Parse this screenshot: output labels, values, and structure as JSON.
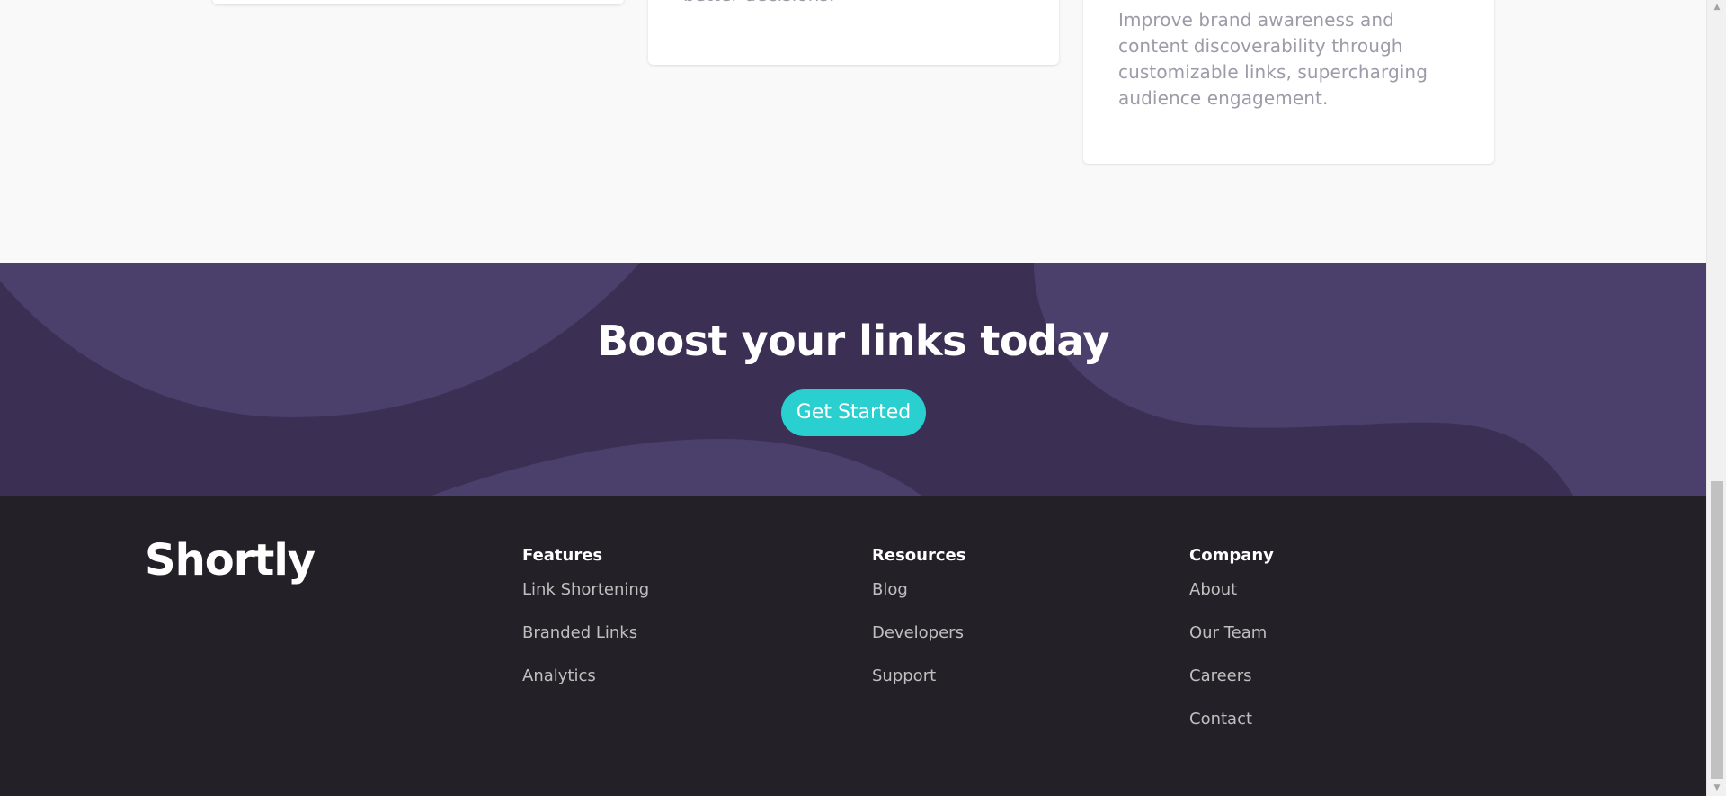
{
  "stats": {
    "cards": [
      {
        "text": ""
      },
      {
        "text": "better decisions."
      },
      {
        "text": "Improve brand awareness and content discoverability through customizable links, supercharging audience engagement."
      }
    ]
  },
  "boost": {
    "title": "Boost your links today",
    "button_label": "Get Started"
  },
  "footer": {
    "logo": "Shortly",
    "columns": [
      {
        "title": "Features",
        "links": [
          "Link Shortening",
          "Branded Links",
          "Analytics"
        ]
      },
      {
        "title": "Resources",
        "links": [
          "Blog",
          "Developers",
          "Support"
        ]
      },
      {
        "title": "Company",
        "links": [
          "About",
          "Our Team",
          "Careers",
          "Contact"
        ]
      }
    ]
  },
  "scrollbar": {
    "up_icon": "▲",
    "down_icon": "▼"
  },
  "colors": {
    "background": "#f9f9f9",
    "boost_bg": "#3b3054",
    "boost_shape": "#4b3f6b",
    "cyan": "#2acfcf",
    "footer_bg": "#232127",
    "text_gray": "#9e9aa7",
    "link_gray": "#bfbfbf"
  }
}
